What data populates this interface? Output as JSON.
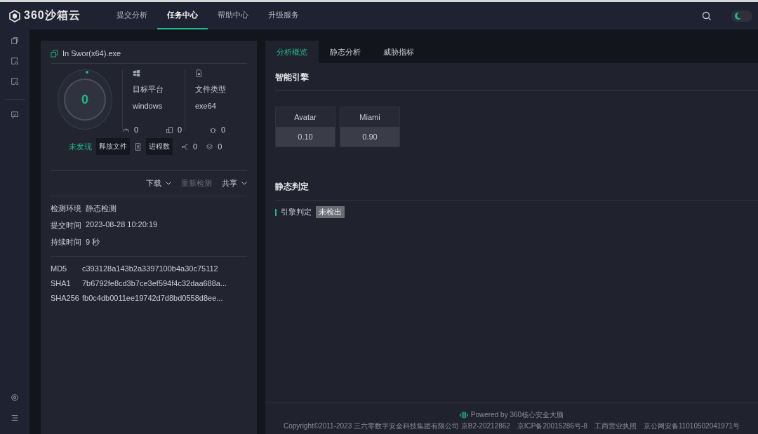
{
  "header": {
    "logo": "360沙箱云",
    "nav": [
      {
        "label": "提交分析",
        "selected": false
      },
      {
        "label": "任务中心",
        "selected": true
      },
      {
        "label": "帮助中心",
        "selected": false
      },
      {
        "label": "升级服务",
        "selected": false
      }
    ],
    "theme_toggle": {
      "on": false
    }
  },
  "sidebar": {
    "top_icons": [
      {
        "kind": "window"
      },
      {
        "kind": "search-doc"
      },
      {
        "kind": "search-doc"
      },
      {
        "kind": "chat"
      }
    ],
    "bottom_icons": [
      {
        "kind": "settings"
      },
      {
        "kind": "menu"
      }
    ]
  },
  "file_card": {
    "filename": "In Swor(x64).exe",
    "score": "0",
    "verdict": "未发现",
    "info": [
      {
        "kind": "windows",
        "label": "目标平台",
        "value": "windows"
      },
      {
        "kind": "file",
        "label": "文件类型",
        "value": "exe64"
      }
    ],
    "stats_row1": [
      {
        "kind": "gauge",
        "value": "0"
      },
      {
        "kind": "building",
        "value": "0"
      },
      {
        "kind": "bug",
        "value": "0"
      }
    ],
    "tooltips": [
      "释放文件",
      "进程数"
    ],
    "stats_row2": [
      {
        "kind": "network",
        "value": "0"
      },
      {
        "kind": "layers",
        "value": "0"
      }
    ],
    "actions": [
      {
        "label": "下载",
        "dropdown": true,
        "disabled": false
      },
      {
        "label": "重新检测",
        "dropdown": false,
        "disabled": true
      },
      {
        "label": "共享",
        "dropdown": true,
        "disabled": false
      }
    ],
    "details": [
      {
        "label": "检测环境",
        "value": "静态检测"
      },
      {
        "label": "提交时间",
        "value": "2023-08-28 10:20:19"
      },
      {
        "label": "持续时间",
        "value": "9 秒"
      }
    ],
    "hashes": [
      {
        "label": "MD5",
        "value": "c393128a143b2a3397100b4a30c75112"
      },
      {
        "label": "SHA1",
        "value": "7b6792fe8cd3b7ce3ef594f4c32daa688a..."
      },
      {
        "label": "SHA256",
        "value": "fb0c4db0011ee19742d7d8bd0558d8ee..."
      }
    ]
  },
  "tabs": [
    {
      "label": "分析概览",
      "selected": true
    },
    {
      "label": "静态分析",
      "selected": false
    },
    {
      "label": "威胁指标",
      "selected": false
    }
  ],
  "engines": {
    "title": "智能引擎",
    "items": [
      {
        "name": "Avatar",
        "score": "0.10"
      },
      {
        "name": "Miami",
        "score": "0.90"
      }
    ]
  },
  "static_verdict": {
    "title": "静态判定",
    "label": "引擎判定",
    "tag": "未检出"
  },
  "footer": {
    "powered": "Powered by 360核心安全大脑",
    "copyright": "Copyright©2011-2023 三六零数字安全科技集团有限公司 京B2-20212862",
    "links": [
      "京ICP备20015286号-8",
      "工商营业执照",
      "京公网安备11010502041971号"
    ]
  }
}
